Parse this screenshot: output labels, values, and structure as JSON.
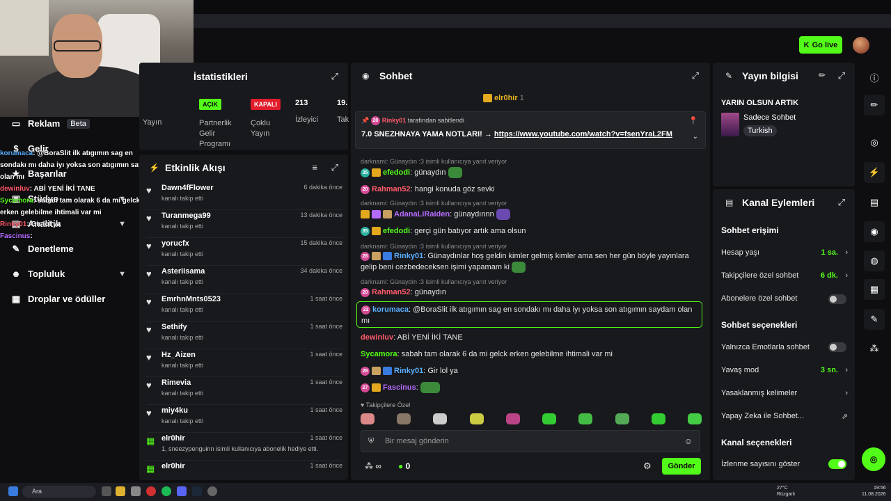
{
  "header": {
    "go_live": "Go live"
  },
  "sidebar": {
    "items": [
      {
        "label": "Reklam",
        "badge": "Beta"
      },
      {
        "label": "Gelir"
      },
      {
        "label": "Başarılar"
      },
      {
        "label": "Stüdyo"
      },
      {
        "label": "Analitik"
      },
      {
        "label": "Denetleme"
      },
      {
        "label": "Topluluk"
      },
      {
        "label": "Droplar ve ödüller"
      }
    ]
  },
  "overlay_chat": {
    "lines": [
      {
        "user": "korumaca",
        "text": ": @BoraSlit ilk atıgımın sag en sondakı mı daha iyı yoksa son atıgımın saydam olan mı"
      },
      {
        "user": "dewinluv",
        "text": ": ABİ YENİ İKİ TANE"
      },
      {
        "user": "Sycamora",
        "text": ": sabah tam olarak 6 da mi gelck erken gelebilme ihtimali var mi"
      },
      {
        "user": "Rinky01",
        "text": ": Gir lol ya"
      },
      {
        "user": "Fascinus",
        "text": ":"
      }
    ]
  },
  "stats": {
    "title": "İstatistikleri",
    "stream_label": "Yayın",
    "partner_badge": "AÇIK",
    "partner_label": "Partnerlik Gelir Programı",
    "multi_badge": "KAPALI",
    "multi_label": "Çoklu Yayın",
    "viewers_value": "213",
    "viewers_label": "İzleyici",
    "fourth_value": "19.",
    "fourth_label": "Tak"
  },
  "activity": {
    "title": "Etkinlik Akışı",
    "rows": [
      {
        "name": "Dawn4fFlower",
        "sub": "kanalı takip etti",
        "time": "6 dakika önce"
      },
      {
        "name": "Turanmega99",
        "sub": "kanalı takip etti",
        "time": "13 dakika önce"
      },
      {
        "name": "yorucfx",
        "sub": "kanalı takip etti",
        "time": "15 dakika önce"
      },
      {
        "name": "Asteriisama",
        "sub": "kanalı takip etti",
        "time": "34 dakika önce"
      },
      {
        "name": "EmrhnMnts0523",
        "sub": "kanalı takip etti",
        "time": "1 saat önce"
      },
      {
        "name": "Sethify",
        "sub": "kanalı takip etti",
        "time": "1 saat önce"
      },
      {
        "name": "Hz_Aizen",
        "sub": "kanalı takip etti",
        "time": "1 saat önce"
      },
      {
        "name": "Rimevia",
        "sub": "kanalı takip etti",
        "time": "1 saat önce"
      },
      {
        "name": "miy4ku",
        "sub": "kanalı takip etti",
        "time": "1 saat önce"
      },
      {
        "name": "elr0hir",
        "sub": "1, sneezypenguinn isimli kullanıcıya abonelik hediye etti.",
        "time": "1 saat önce"
      },
      {
        "name": "elr0hir",
        "sub": "",
        "time": "1 saat önce"
      }
    ]
  },
  "chat": {
    "title": "Sohbet",
    "top_gifter": "elr0hir",
    "top_gifter_count": "1",
    "pinned_by": "Rinky01",
    "pinned_suffix": "tarafından sabitlendi",
    "pinned_text": "7.0 SNEZHNAYA YAMA NOTLARI! →",
    "pinned_link": "https://www.youtube.com/watch?v=fsenYraL2FM",
    "replies": [
      "darknami: Günaydın :3 isimli kullanıcıya yanıt veriyor",
      "darknami: Günaydın :3 isimli kullanıcıya yanıt veriyor",
      "darknami: Günaydın :3 isimli kullanıcıya yanıt veriyor",
      "darknami: Günaydın :3 isimli kullanıcıya yanıt veriyor"
    ],
    "messages": [
      {
        "level": "35",
        "user": "efedodi",
        "text": ": günaydın"
      },
      {
        "level": "20",
        "user": "Rahman52",
        "text": ": hangi konuda göz sevki"
      },
      {
        "level": "",
        "user": "AdanaLiRaiden",
        "text": ": günaydınnn"
      },
      {
        "level": "35",
        "user": "efedodi",
        "text": ": gerçi gün batıyor artık ama olsun"
      },
      {
        "level": "28",
        "user": "Rinky01",
        "text": ": Günaydınlar hoş geldin kimler gelmiş kimler ama sen her gün böyle yayınlara gelip beni cezbedeceksen işimi yapamam ki"
      },
      {
        "level": "20",
        "user": "Rahman52",
        "text": ": günaydın"
      },
      {
        "level": "22",
        "user": "korumaca",
        "text": ": @BoraSlit ilk atıgımın sag en sondakı mı daha iyı yoksa son atıgımın saydam olan mı"
      },
      {
        "level": "",
        "user": "dewinluv",
        "text": ": ABİ YENİ İKİ TANE"
      },
      {
        "level": "",
        "user": "Sycamora",
        "text": ": sabah tam olarak 6 da mi gelck erken gelebilme ihtimali var mi"
      },
      {
        "level": "28",
        "user": "Rinky01",
        "text": ": Gir lol ya"
      },
      {
        "level": "27",
        "user": "Fascinus",
        "text": ":"
      }
    ],
    "followers_only": "Takipçilere Özel",
    "input_placeholder": "Bir mesaj gönderin",
    "infinity": "∞",
    "points": "0",
    "send": "Gönder"
  },
  "info": {
    "title": "Yayın bilgisi",
    "stream_title": "YARIN OLSUN ARTIK",
    "category": "Sadece Sohbet",
    "language": "Turkish"
  },
  "actions": {
    "title": "Kanal Eylemleri",
    "chat_access": "Sohbet erişimi",
    "account_age": "Hesap yaşı",
    "account_age_val": "1 sa.",
    "followers_chat": "Takipçilere özel sohbet",
    "followers_chat_val": "6 dk.",
    "subs_chat": "Abonelere özel sohbet",
    "chat_options": "Sohbet seçenekleri",
    "emote_only": "Yalnızca Emotlarla sohbet",
    "slow_mode": "Yavaş mod",
    "slow_mode_val": "3 sn.",
    "banned_words": "Yasaklanmış kelimeler",
    "ai_chat": "Yapay Zeka ile Sohbet...",
    "channel_options": "Kanal seçenekleri",
    "show_viewers": "İzlenme sayısını göster"
  },
  "taskbar": {
    "search": "Ara",
    "weather_temp": "27°C",
    "weather_desc": "Rüzgarlı",
    "time": "19:56",
    "date": "11.08.2026"
  }
}
